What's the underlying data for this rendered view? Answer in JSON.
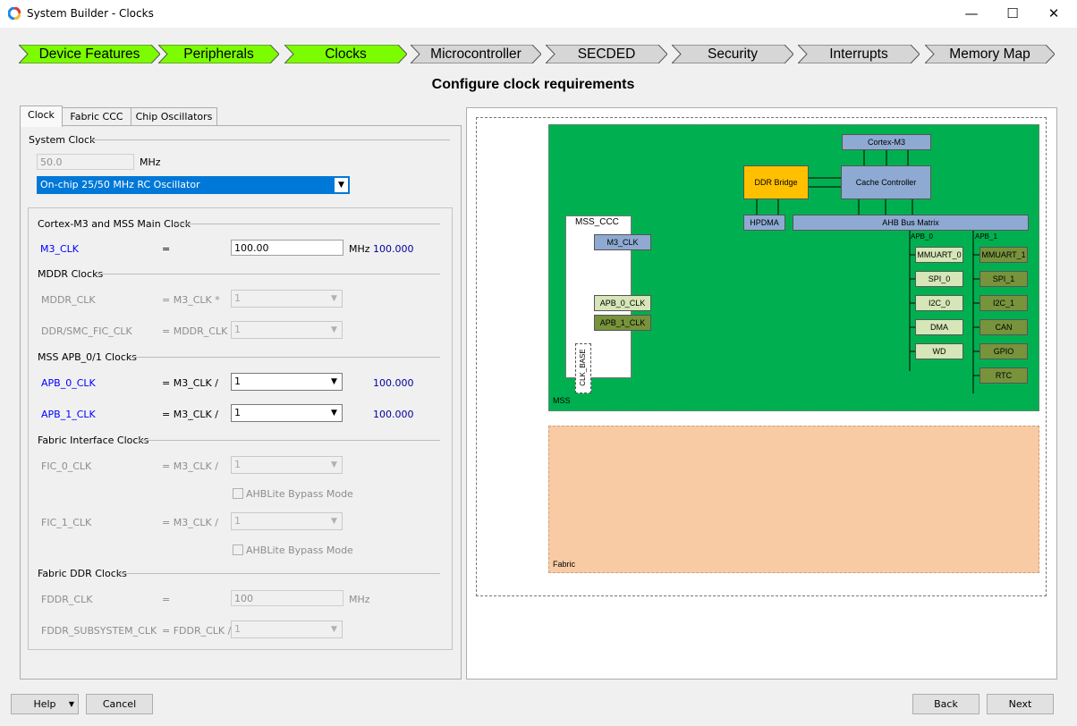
{
  "window": {
    "title": "System Builder - Clocks",
    "minimize": "—",
    "maximize": "☐",
    "close": "✕"
  },
  "steps": [
    {
      "label": "Device Features",
      "state": "done"
    },
    {
      "label": "Peripherals",
      "state": "done"
    },
    {
      "label": "Clocks",
      "state": "current"
    },
    {
      "label": "Microcontroller",
      "state": "todo"
    },
    {
      "label": "SECDED",
      "state": "todo"
    },
    {
      "label": "Security",
      "state": "todo"
    },
    {
      "label": "Interrupts",
      "state": "todo"
    },
    {
      "label": "Memory Map",
      "state": "todo"
    }
  ],
  "heading": "Configure clock requirements",
  "tabs": [
    "Clock",
    "Fabric CCC",
    "Chip Oscillators"
  ],
  "system_clock": {
    "group": "System Clock",
    "freq": "50.0",
    "unit": "MHz",
    "source": "On-chip 25/50 MHz RC Oscillator"
  },
  "main_clock": {
    "group": "Cortex-M3 and MSS Main Clock",
    "name": "M3_CLK",
    "eq": "=",
    "value": "100.00",
    "unit": "MHz",
    "result": "100.000"
  },
  "mddr": {
    "group": "MDDR Clocks",
    "mddr_name": "MDDR_CLK",
    "mddr_eq": "= M3_CLK *",
    "mddr_value": "1",
    "ddr_name": "DDR/SMC_FIC_CLK",
    "ddr_eq": "= MDDR_CLK /",
    "ddr_value": "1"
  },
  "apb": {
    "group": "MSS APB_0/1 Clocks",
    "apb0_name": "APB_0_CLK",
    "apb0_eq": "= M3_CLK /",
    "apb0_value": "1",
    "apb0_result": "100.000",
    "apb1_name": "APB_1_CLK",
    "apb1_eq": "= M3_CLK /",
    "apb1_value": "1",
    "apb1_result": "100.000"
  },
  "fic": {
    "group": "Fabric Interface Clocks",
    "fic0_name": "FIC_0_CLK",
    "fic0_eq": "= M3_CLK /",
    "fic0_value": "1",
    "bypass0": "AHBLite Bypass Mode",
    "fic1_name": "FIC_1_CLK",
    "fic1_eq": "= M3_CLK /",
    "fic1_value": "1",
    "bypass1": "AHBLite Bypass Mode"
  },
  "fddr": {
    "group": "Fabric DDR Clocks",
    "fddr_name": "FDDR_CLK",
    "fddr_eq": "=",
    "fddr_value": "100",
    "fddr_unit": "MHz",
    "sub_name": "FDDR_SUBSYSTEM_CLK",
    "sub_eq": "= FDDR_CLK /",
    "sub_value": "1"
  },
  "diagram": {
    "cortex": "Cortex-M3",
    "ddr_bridge": "DDR Bridge",
    "cache": "Cache Controller",
    "hpdma": "HPDMA",
    "ahb": "AHB Bus Matrix",
    "mss_ccc": "MSS_CCC",
    "m3_clk": "M3_CLK",
    "apb0_clk": "APB_0_CLK",
    "apb1_clk": "APB_1_CLK",
    "clk_base": "CLK_BASE",
    "apb0_bus": "APB_0",
    "apb1_bus": "APB_1",
    "apb0_periphs": [
      "MMUART_0",
      "SPI_0",
      "I2C_0",
      "DMA",
      "WD"
    ],
    "apb1_periphs": [
      "MMUART_1",
      "SPI_1",
      "I2C_1",
      "CAN",
      "GPIO",
      "RTC"
    ],
    "mss_label": "MSS",
    "fabric_label": "Fabric",
    "colors": {
      "mss": "#00b050",
      "fabric": "#f8cba4",
      "bridge": "#ffc000",
      "blue": "#8eaad2",
      "apb0": "#d6e6b8",
      "apb1": "#77933c"
    }
  },
  "buttons": {
    "help": "Help",
    "cancel": "Cancel",
    "back": "Back",
    "next": "Next"
  }
}
